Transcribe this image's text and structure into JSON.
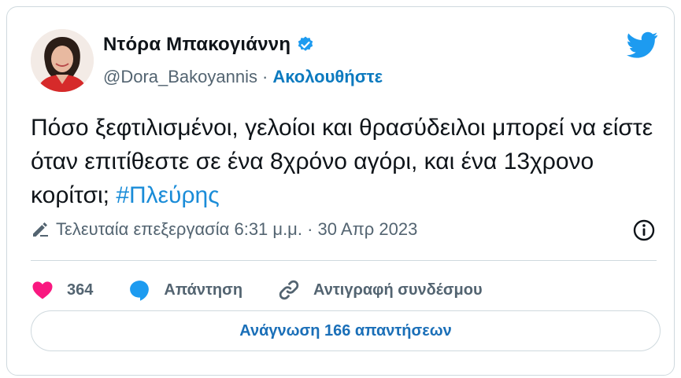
{
  "author": {
    "name": "Ντόρα Μπακογιάννη",
    "handle": "@Dora_Bakoyannis",
    "separator": "·",
    "follow_label": "Ακολουθήστε",
    "verified": true
  },
  "tweet": {
    "text": "Πόσο ξεφτιλισμένοι, γελοίοι και θρασύδειλοι μπορεί να είστε όταν επιτίθεστε σε ένα 8χρόνο αγόρι, και ένα 13χρονο κορίτσι; ",
    "hashtag": "#Πλεύρης"
  },
  "meta": {
    "edited_label": "Τελευταία επεξεργασία 6:31 μ.μ. · 30 Απρ 2023"
  },
  "actions": {
    "like_count": "364",
    "reply_label": "Απάντηση",
    "copy_link_label": "Αντιγραφή συνδέσμου"
  },
  "footer": {
    "read_replies_label": "Ανάγνωση 166 απαντήσεων"
  },
  "colors": {
    "accent": "#1d9bf0",
    "like": "#f91880",
    "text": "#0f1419",
    "muted": "#536471",
    "border": "#cfd9de"
  },
  "icons": [
    "avatar",
    "verified-badge-icon",
    "twitter-bird-icon",
    "pencil-icon",
    "info-icon",
    "heart-icon",
    "reply-bubble-icon",
    "link-icon"
  ]
}
